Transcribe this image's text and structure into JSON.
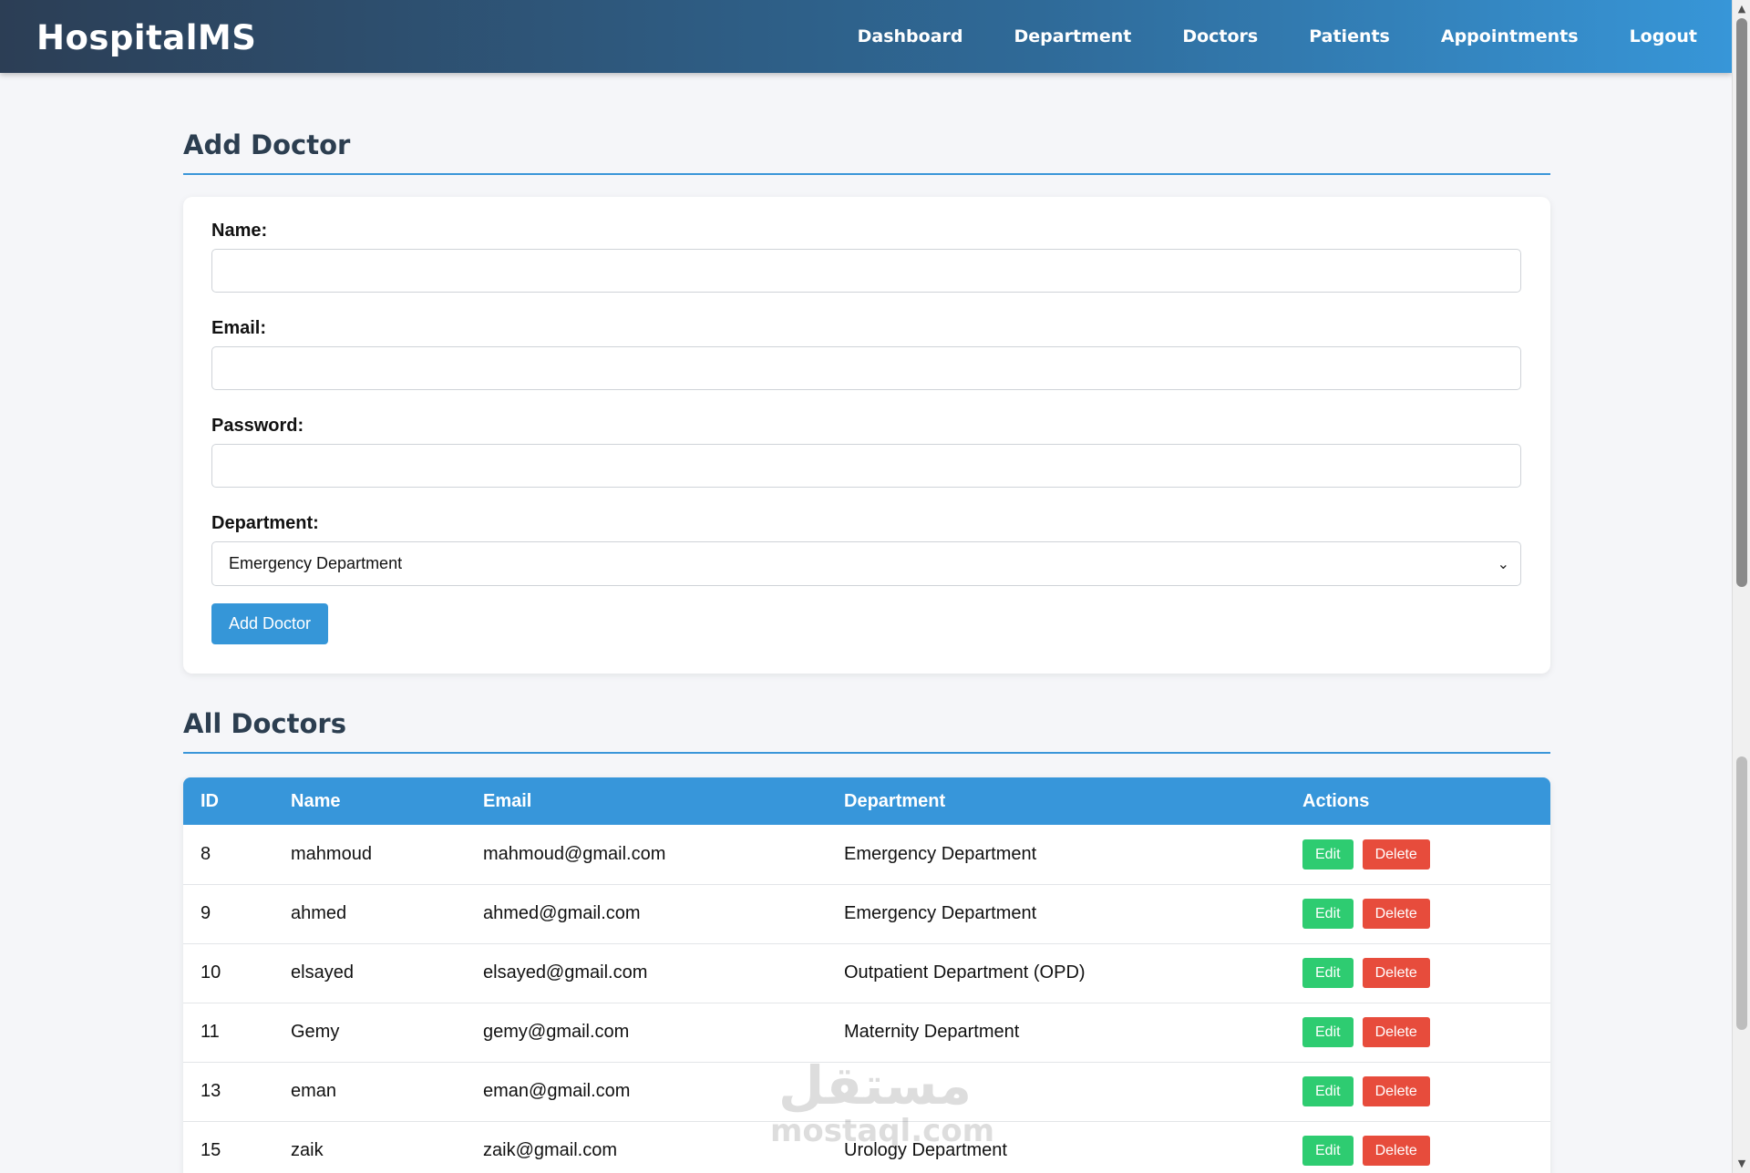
{
  "navbar": {
    "brand": "HospitalMS",
    "links": [
      "Dashboard",
      "Department",
      "Doctors",
      "Patients",
      "Appointments",
      "Logout"
    ]
  },
  "add_doctor": {
    "title": "Add Doctor",
    "name_label": "Name:",
    "name_value": "",
    "email_label": "Email:",
    "email_value": "",
    "password_label": "Password:",
    "password_value": "",
    "department_label": "Department:",
    "department_selected": "Emergency Department",
    "submit_label": "Add Doctor"
  },
  "all_doctors": {
    "title": "All Doctors",
    "columns": [
      "ID",
      "Name",
      "Email",
      "Department",
      "Actions"
    ],
    "edit_label": "Edit",
    "delete_label": "Delete",
    "rows": [
      {
        "id": "8",
        "name": "mahmoud",
        "email": "mahmoud@gmail.com",
        "department": "Emergency Department"
      },
      {
        "id": "9",
        "name": "ahmed",
        "email": "ahmed@gmail.com",
        "department": "Emergency Department"
      },
      {
        "id": "10",
        "name": "elsayed",
        "email": "elsayed@gmail.com",
        "department": "Outpatient Department (OPD)"
      },
      {
        "id": "11",
        "name": "Gemy",
        "email": "gemy@gmail.com",
        "department": "Maternity Department"
      },
      {
        "id": "13",
        "name": "eman",
        "email": "eman@gmail.com",
        "department": ""
      },
      {
        "id": "15",
        "name": "zaik",
        "email": "zaik@gmail.com",
        "department": "Urology Department"
      }
    ]
  },
  "watermark": {
    "logo": "مستقل",
    "text": "mostaql.com"
  },
  "icons": {
    "select_chevron": "chevron-down-icon",
    "scroll_up": "arrow-up-icon",
    "scroll_down": "arrow-down-icon"
  }
}
